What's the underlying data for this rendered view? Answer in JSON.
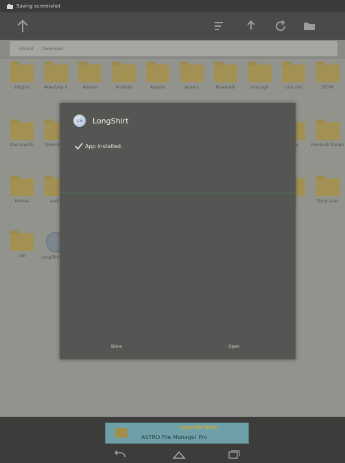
{
  "status_bar": {
    "text": "Saving screenshot",
    "icon": "screenshot-notification-icon"
  },
  "action_bar": {
    "icons": [
      "up-arrow-icon",
      "sort-icon",
      "share-icon",
      "refresh-icon",
      "folder-icon"
    ]
  },
  "path_bar": {
    "segments": [
      "sdcard",
      "Download"
    ]
  },
  "files": [
    {
      "name": "2digital",
      "type": "folder"
    },
    {
      "name": "AnerCrop d",
      "type": "folder"
    },
    {
      "name": "Alarms",
      "type": "folder"
    },
    {
      "name": "Android",
      "type": "folder"
    },
    {
      "name": "AppGlo",
      "type": "folder"
    },
    {
      "name": "aquary",
      "type": "folder"
    },
    {
      "name": "bluetooth",
      "type": "folder"
    },
    {
      "name": "com.pgo",
      "type": "folder"
    },
    {
      "name": "com.zoki",
      "type": "folder"
    },
    {
      "name": "DCIM",
      "type": "folder"
    },
    {
      "name": "Documents",
      "type": "folder"
    },
    {
      "name": "Downloa d",
      "type": "folder"
    },
    {
      "name": "",
      "type": "folder"
    },
    {
      "name": "",
      "type": "folder"
    },
    {
      "name": "",
      "type": "folder"
    },
    {
      "name": "",
      "type": "folder"
    },
    {
      "name": "",
      "type": "folder"
    },
    {
      "name": "",
      "type": "folder"
    },
    {
      "name": "ease",
      "type": "folder"
    },
    {
      "name": "MoriLock Range",
      "type": "folder"
    },
    {
      "name": "Movies",
      "type": "folder"
    },
    {
      "name": "andro",
      "type": "folder"
    },
    {
      "name": "",
      "type": "folder"
    },
    {
      "name": "",
      "type": "folder"
    },
    {
      "name": "",
      "type": "folder"
    },
    {
      "name": "",
      "type": "folder"
    },
    {
      "name": "",
      "type": "folder"
    },
    {
      "name": "",
      "type": "folder"
    },
    {
      "name": "ed",
      "type": "folder"
    },
    {
      "name": "Templ ates",
      "type": "folder"
    },
    {
      "name": "xlib",
      "type": "folder"
    },
    {
      "name": "LongShirt Fast",
      "type": "apk"
    }
  ],
  "dialog": {
    "app_name": "LongShirt",
    "app_icon_text": "LS",
    "status": "App installed.",
    "done_label": "Done",
    "open_label": "Open"
  },
  "banner": {
    "line1": "Upgrade Now!",
    "line2": "ASTRO File Manager Pro"
  },
  "nav": {
    "icons": [
      "back-icon",
      "home-icon",
      "recent-apps-icon"
    ]
  }
}
